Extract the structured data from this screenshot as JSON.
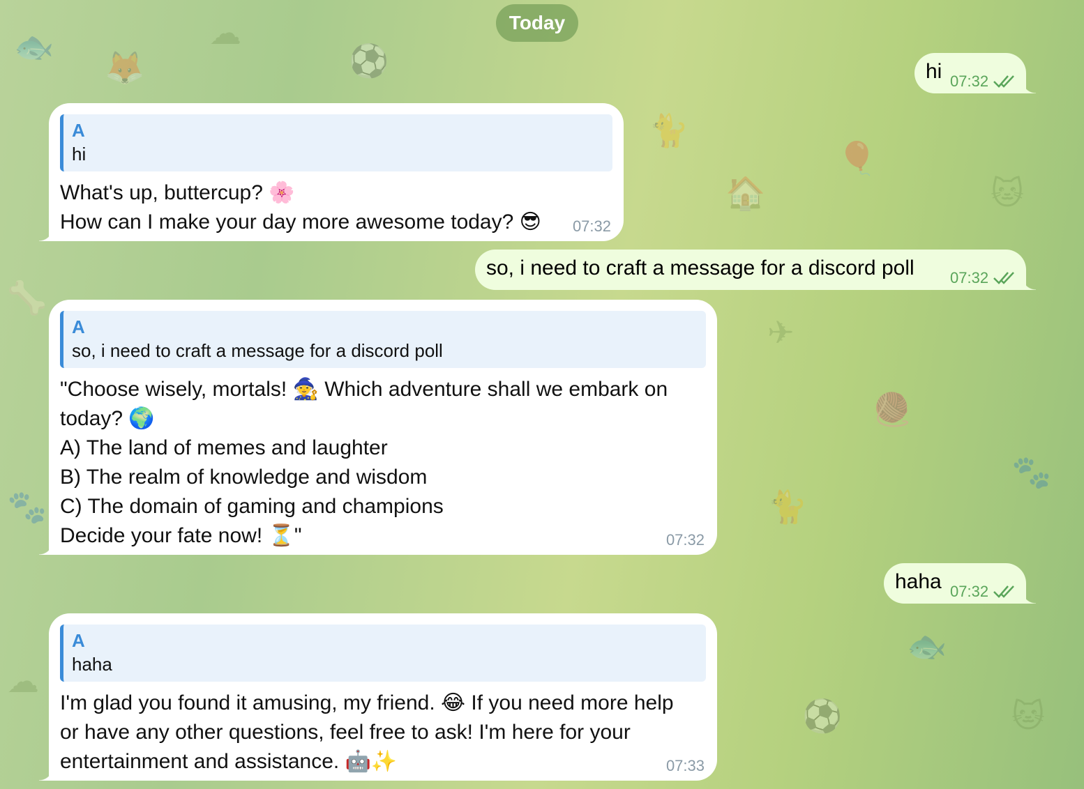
{
  "date_chip": "Today",
  "outgoing": [
    {
      "text": "hi",
      "time": "07:32"
    },
    {
      "text": "so, i need to craft a message for a discord poll",
      "time": "07:32"
    },
    {
      "text": "haha",
      "time": "07:32"
    }
  ],
  "incoming": [
    {
      "reply_name": "A",
      "reply_text": "hi",
      "lines": [
        "What's up, buttercup? 🌸",
        "How can I make your day more awesome today? 😎"
      ],
      "time": "07:32"
    },
    {
      "reply_name": "A",
      "reply_text": "so, i need to craft a message for a discord poll",
      "lines": [
        "\"Choose wisely, mortals! 🧙 Which adventure shall we embark on",
        "today? 🌍",
        "A) The land of memes and laughter",
        "B) The realm of knowledge and wisdom",
        "C) The domain of gaming and champions",
        "Decide your fate now! ⏳\""
      ],
      "time": "07:32"
    },
    {
      "reply_name": "A",
      "reply_text": "haha",
      "lines": [
        "I'm glad you found it amusing, my friend. 😂 If you need more help",
        "or have any other questions, feel free to ask! I'm here for your",
        "entertainment and assistance. 🤖✨"
      ],
      "time": "07:33"
    }
  ],
  "colors": {
    "incoming_bubble": "#ffffff",
    "outgoing_bubble": "#effdde",
    "reply_accent": "#3a8bd8",
    "read_checks": "#5aa55a"
  },
  "icons": {
    "read_receipt": "double-check-icon",
    "background": "doodle-pattern"
  }
}
